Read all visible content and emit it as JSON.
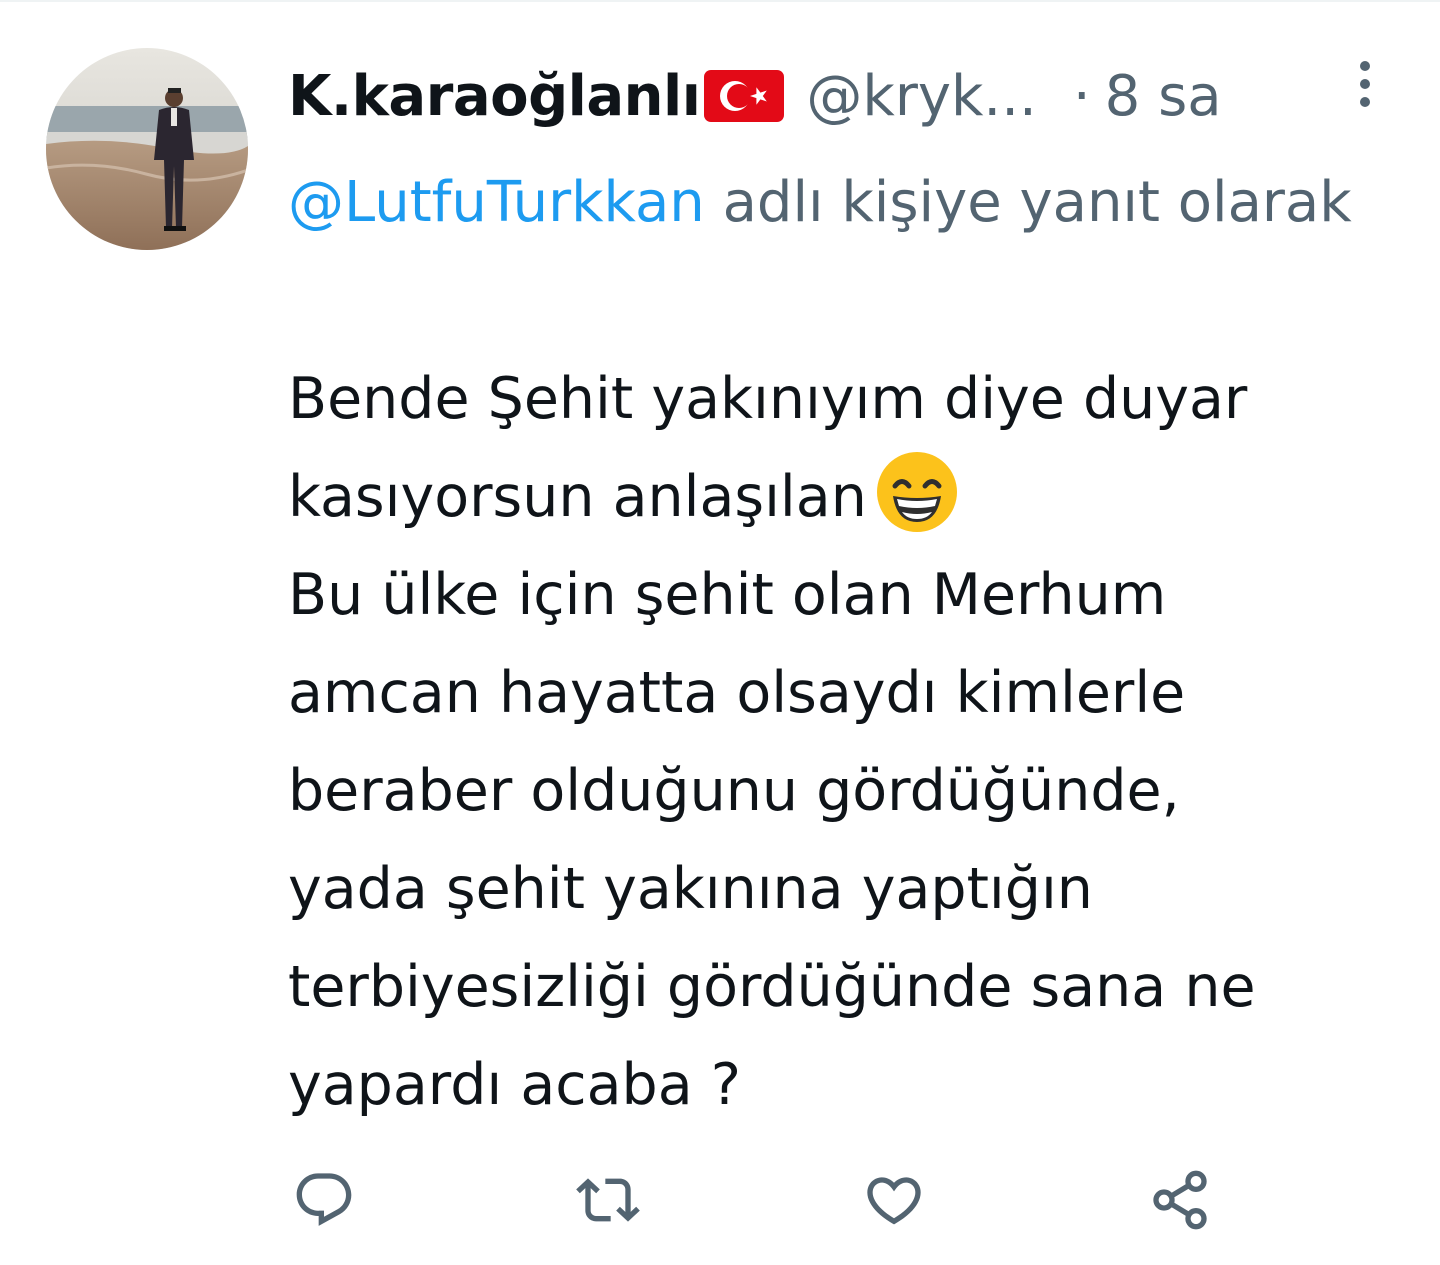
{
  "tweet": {
    "author": {
      "display_name": "K.karaoğlanlı",
      "handle": "@kryk...",
      "flag_icon": "turkey-flag-icon",
      "avatar": "profile-photo-beach"
    },
    "separator": "·",
    "time": "8 sa",
    "reply_to": {
      "mention": "@LutfuTurkkan",
      "suffix": " adlı kişiye yanıt olarak"
    },
    "text_lines": [
      "Bende Şehit yakınıyım diye duyar",
      "kasıyorsun anlaşılan",
      "Bu ülke için şehit olan Merhum",
      "amcan hayatta olsaydı kimlerle",
      "beraber olduğunu gördüğünde,",
      "yada şehit yakınına yaptığın",
      "terbiyesizliği gördüğünde sana ne",
      "yapardı acaba ?"
    ],
    "emoji": "grinning-face-with-smiling-eyes-emoji",
    "actions": [
      {
        "name": "reply",
        "icon": "reply-icon"
      },
      {
        "name": "retweet",
        "icon": "retweet-icon"
      },
      {
        "name": "like",
        "icon": "heart-icon"
      },
      {
        "name": "share",
        "icon": "share-icon"
      }
    ],
    "more_icon": "more-vertical-icon"
  },
  "colors": {
    "text": "#0f1419",
    "secondary": "#536471",
    "link": "#1d9bf0",
    "flag_red": "#e30a17"
  }
}
